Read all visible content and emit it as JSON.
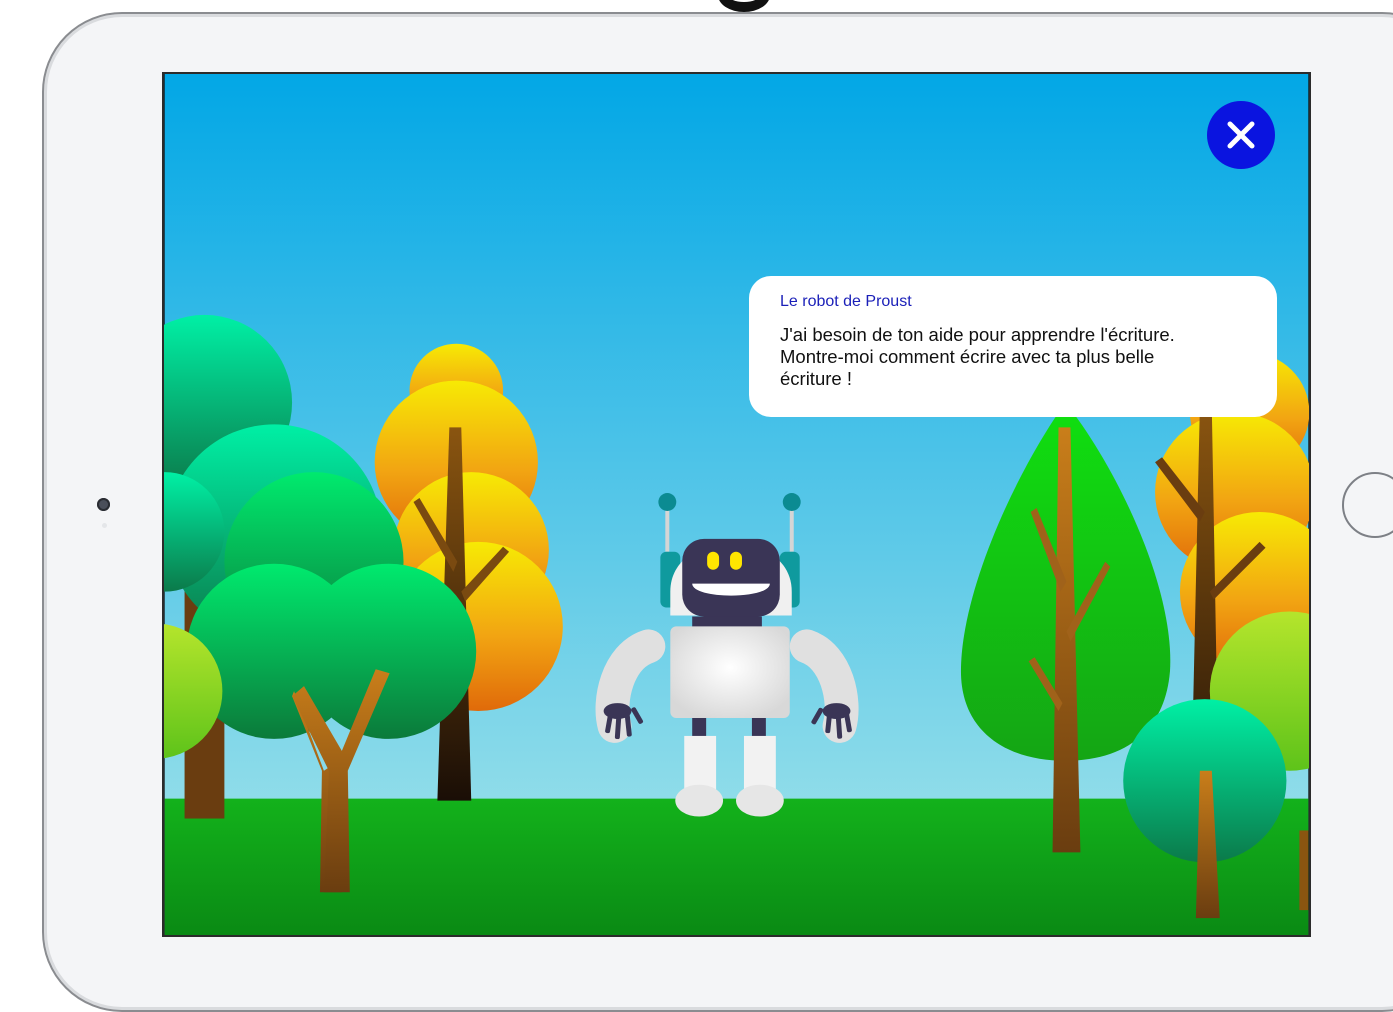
{
  "dialog": {
    "speaker": "Le robot de Proust",
    "message": "J'ai besoin de ton aide pour apprendre l'écriture.\nMontre-moi comment écrire avec ta plus belle\nécriture !"
  },
  "close_button": {
    "icon": "close-icon"
  },
  "device": {
    "camera_icon": "camera-icon",
    "home_icon": "home-button"
  },
  "colors": {
    "accent": "#0a14e0",
    "sky_top": "#02a7e6",
    "sky_bottom": "#a9e6ea",
    "grass": "#0fa81a",
    "speaker_name": "#1a1fb8"
  }
}
